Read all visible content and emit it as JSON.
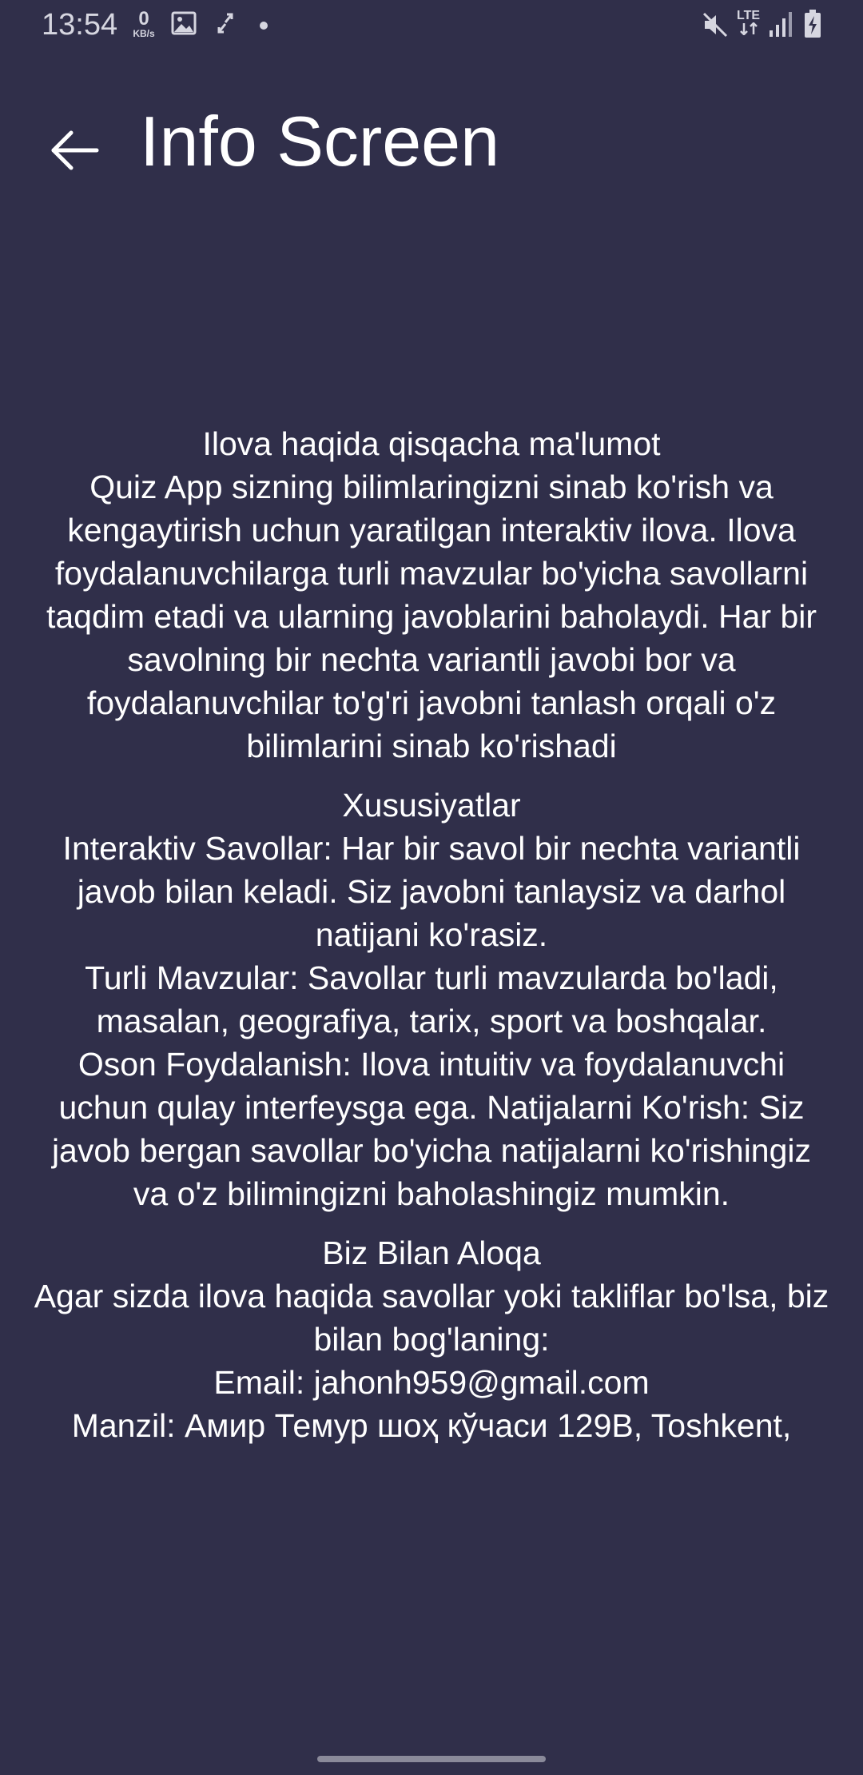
{
  "status_bar": {
    "time": "13:54",
    "net_speed_value": "0",
    "net_speed_unit": "KB/s",
    "network_type_top": "LTE",
    "icons": [
      "image-icon",
      "sync-icon",
      "dot-icon",
      "mute-icon",
      "lte-icon",
      "signal-icon",
      "battery-charging-icon"
    ]
  },
  "app_bar": {
    "title": "Info Screen",
    "back_icon": "arrow-back-icon"
  },
  "content": {
    "about": {
      "heading": "Ilova haqida qisqacha ma'lumot",
      "body": "Quiz App sizning bilimlaringizni sinab ko'rish va kengaytirish uchun yaratilgan interaktiv ilova. Ilova foydalanuvchilarga turli mavzular bo'yicha savollarni taqdim etadi va ularning javoblarini baholaydi. Har bir savolning bir nechta variantli javobi bor va foydalanuvchilar to'g'ri javobni tanlash orqali o'z bilimlarini sinab ko'rishadi"
    },
    "features": {
      "heading": "Xususiyatlar",
      "item1": "Interaktiv Savollar: Har bir savol bir nechta variantli javob bilan keladi. Siz javobni tanlaysiz va darhol natijani ko'rasiz.",
      "item2": "Turli Mavzular: Savollar turli mavzularda bo'ladi, masalan, geografiya, tarix, sport va boshqalar.",
      "item3": "Oson Foydalanish: Ilova intuitiv va foydalanuvchi uchun qulay interfeysga ega. Natijalarni Ko'rish: Siz javob bergan savollar bo'yicha natijalarni ko'rishingiz va o'z bilimingizni baholashingiz mumkin."
    },
    "contact": {
      "heading": "Biz Bilan Aloqa",
      "intro": "Agar sizda ilova haqida savollar yoki takliflar bo'lsa, biz bilan bog'laning:",
      "email": "Email: jahonh959@gmail.com",
      "address": "Manzil: Амир Темур шоҳ кўчаси 129B, Toshkent,"
    }
  },
  "colors": {
    "background": "#302f4a",
    "text": "#ffffff",
    "status_text": "#d6d6e0"
  }
}
